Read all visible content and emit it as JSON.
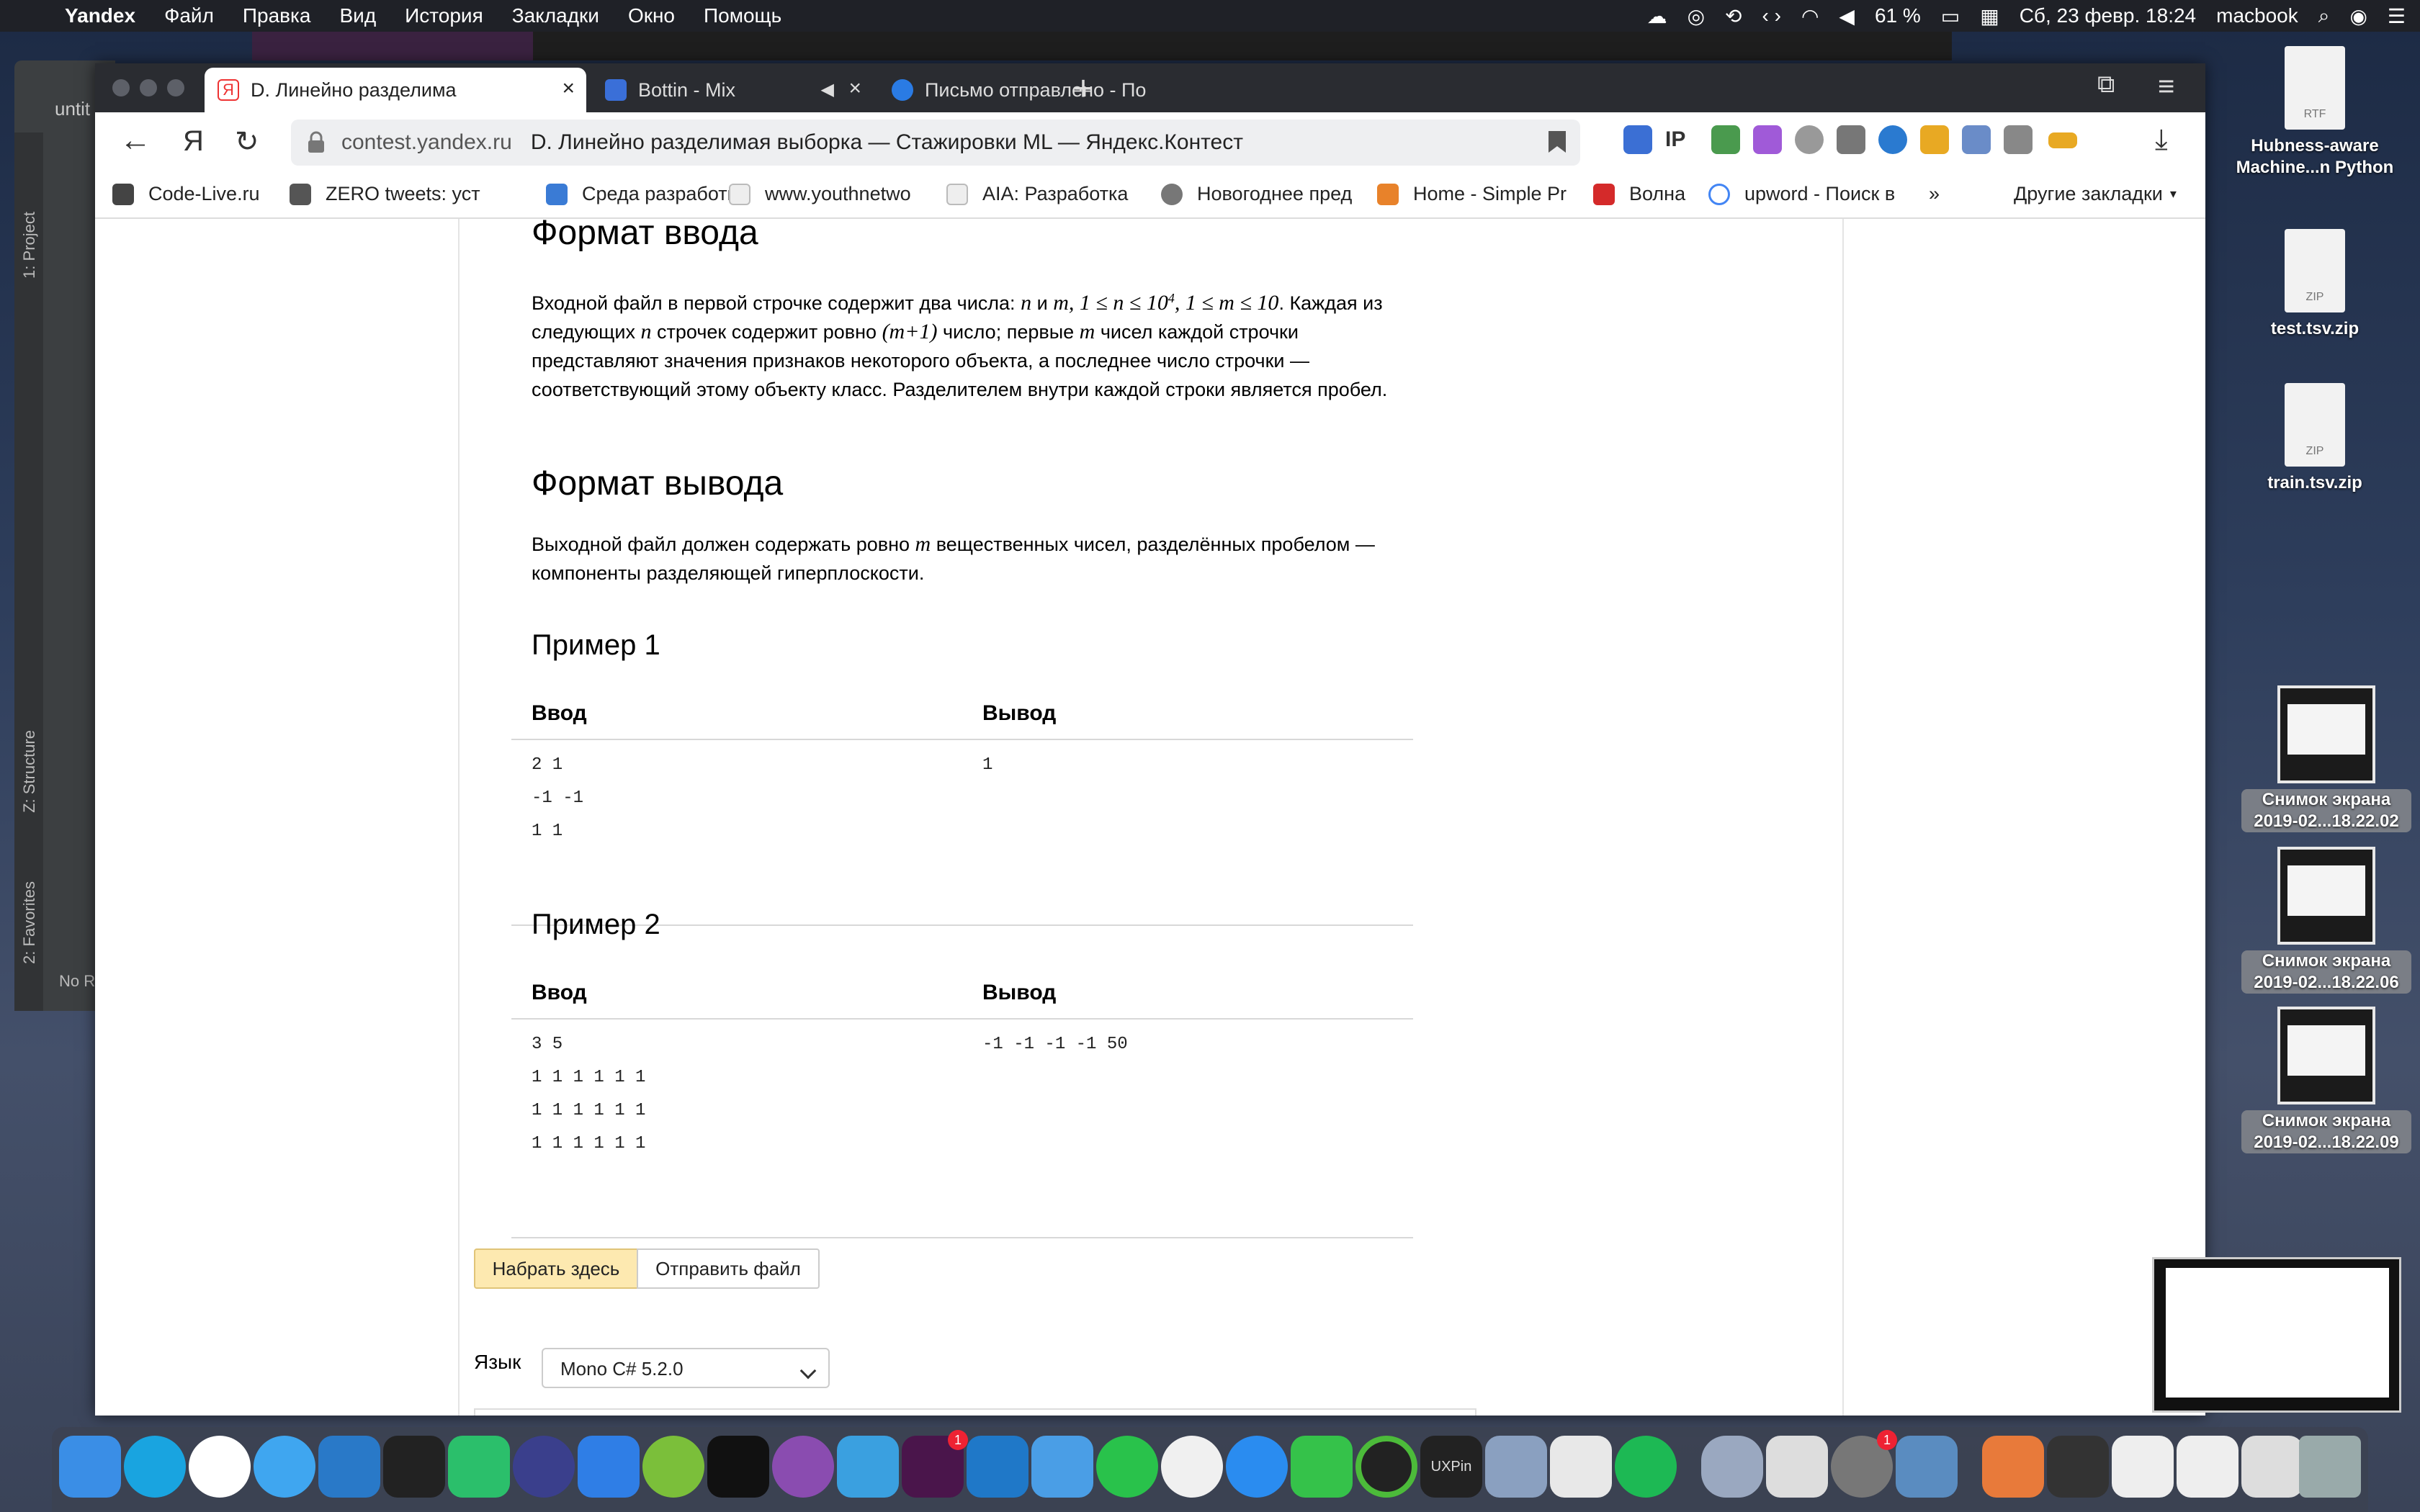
{
  "menubar": {
    "app": "Yandex",
    "items": [
      "Файл",
      "Правка",
      "Вид",
      "История",
      "Закладки",
      "Окно",
      "Помощь"
    ],
    "battery": "61 %",
    "datetime": "Сб, 23 февр.  18:24",
    "user": "macbook"
  },
  "ide": {
    "project_label": "1: Project",
    "structure_label": "Z: Structure",
    "favorites_label": "2: Favorites",
    "title_fragment": "untit",
    "status_fragment": "No R"
  },
  "tabs": [
    {
      "label": "D. Линейно разделима",
      "active": true
    },
    {
      "label": "Bottin - Mix",
      "active": false
    },
    {
      "label": "Письмо отправлено - По",
      "active": false
    }
  ],
  "address": {
    "host": "contest.yandex.ru",
    "title": "D. Линейно разделимая выборка — Стажировки ML — Яндекс.Контест"
  },
  "extensions": {
    "ip_label": "IP"
  },
  "bookmarks": [
    "Code-Live.ru",
    "ZERO tweets: уст",
    "Среда разработк",
    "www.youthnetwo",
    "AIA: Разработка",
    "Новогоднее пред",
    "Home - Simple Pr",
    "Волна",
    "upword - Поиск в"
  ],
  "bookmarks_other": "Другие закладки",
  "content": {
    "input_heading": "Формат ввода",
    "input_text_1": "Входной файл в первой строчке содержит два числа:",
    "input_n": "n",
    "input_and": "и",
    "input_m": "m",
    "input_constraints": "1 ≤ n ≤ 10",
    "input_exp": "4",
    "input_constraints2": ", 1 ≤ m ≤ 10",
    "input_text_2": ". Каждая из",
    "input_line2a": "следующих",
    "input_line2b": "строчек содержит ровно",
    "input_m1": "(m+1)",
    "input_line2c": "число; первые",
    "input_line2d": "чисел каждой строчки",
    "input_line3": "представляют значения признаков некоторого объекта, а последнее число строчки —",
    "input_line4": "соответствующий этому объекту класс. Разделителем внутри каждой строки является пробел.",
    "output_heading": "Формат вывода",
    "output_line1a": "Выходной файл должен содержать ровно",
    "output_line1b": "вещественных чисел, разделённых пробелом —",
    "output_line2": "компоненты разделяющей гиперплоскости.",
    "col_input": "Ввод",
    "col_output": "Вывод",
    "examples": [
      {
        "title": "Пример 1",
        "input": "2 1\n-1 -1\n1 1",
        "output": "1"
      },
      {
        "title": "Пример 2",
        "input": "3 5\n1 1 1 1 1 1\n1 1 1 1 1 1\n1 1 1 1 1 1",
        "output": "-1 -1 -1 -1 50"
      }
    ],
    "lang_label": "Язык",
    "lang_value": "Mono C# 5.2.0",
    "btn_type": "Набрать здесь",
    "btn_upload": "Отправить файл"
  },
  "desktop": [
    {
      "name": "Hubness-aware Machine...n Python",
      "kind": "RTF"
    },
    {
      "name": "test.tsv.zip",
      "kind": "ZIP"
    },
    {
      "name": "train.tsv.zip",
      "kind": "ZIP"
    },
    {
      "name": "Снимок экрана 2019-02...18.22.02"
    },
    {
      "name": "Снимок экрана 2019-02...18.22.06"
    },
    {
      "name": "Снимок экрана 2019-02...18.22.09"
    }
  ],
  "dock": {
    "uxpin_label": "UXPin",
    "badges": [
      "1",
      "1"
    ]
  },
  "colors": {
    "accent_button": "#fde9b0",
    "menubar": "#1f2127",
    "tabbar": "#2a2c31"
  }
}
